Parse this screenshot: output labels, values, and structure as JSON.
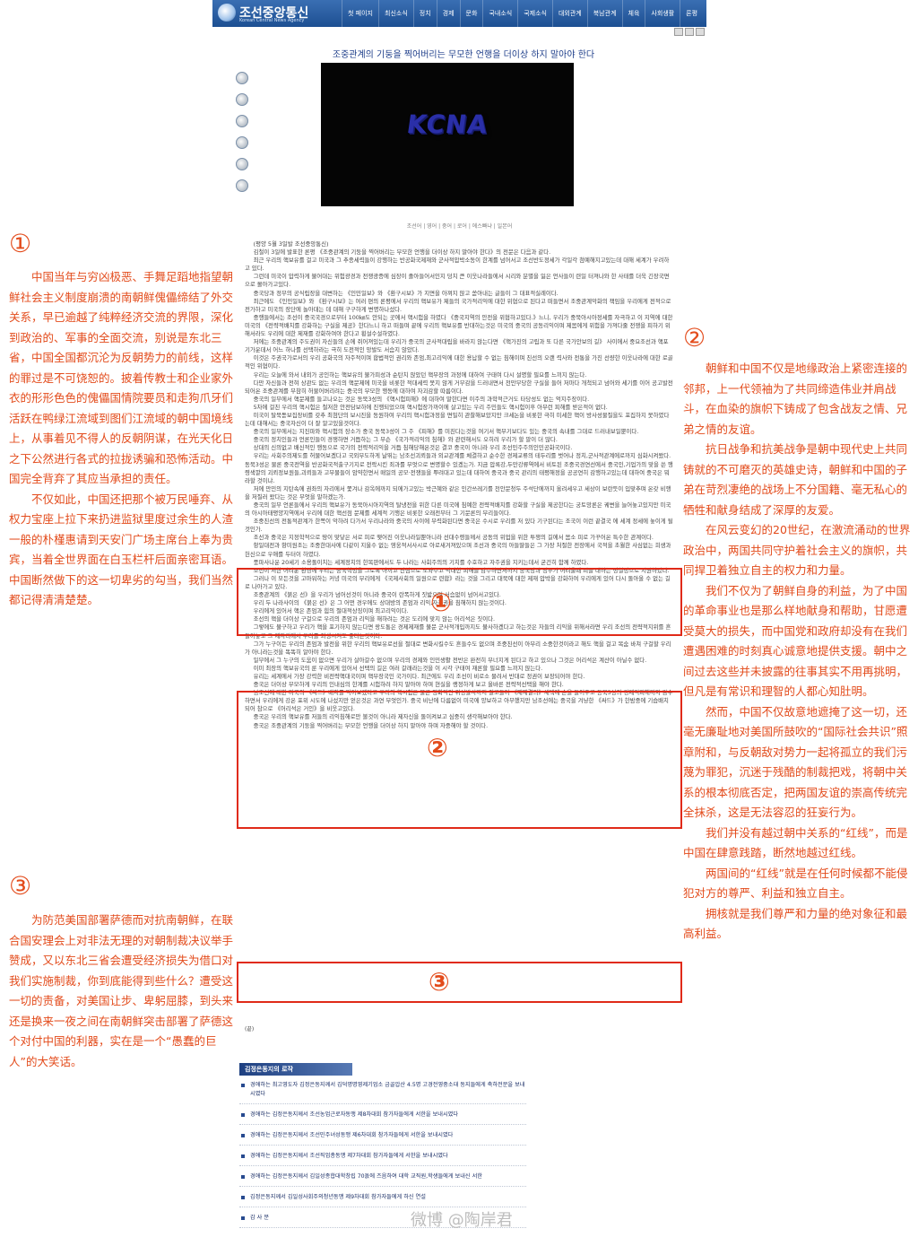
{
  "header": {
    "logo_title": "조선중앙통신",
    "logo_subtitle": "Korean Central News Agency",
    "nav": [
      "첫 페이지",
      "최신소식",
      "정치",
      "경제",
      "문화",
      "국내소식",
      "국제소식",
      "대외관계",
      "북남관계",
      "체육",
      "사회생활",
      "론평"
    ]
  },
  "article": {
    "headline": "조중관계의 기둥을 찍어버리는 무모한 언행을 더이상 하지 말아야 한다",
    "video_logo": "KCNA",
    "languages": "조선어 | 영어 | 중어 | 로어 | 에스빠냐 | 일본어",
    "paragraphs": [
      "(평양 5월 3일발 조선중앙통신)",
      "김철이 3일에 발표한 론평 《조중관계의 기둥을 찍어버리는 무모한 언행을 더이상 하지 말아야 한다》의 전문은 다음과 같다.",
      "최근 우리의 핵보유를 걸고 미국과 그 추종세력들이 강행하는 반공화국제재와 군사적압박소동이 한계를 넘어서고 조선반도정세가 각일각 첨예해지고있는데 대해 세계가 우려하고 있다.",
      "그런데 미국이 압력하게 불어대는 위험광경과 전쟁광증에 심장이 졸아들어서인지 덩치 큰 이웃나라들에서 시리와 분별을 잃은 언사들이 련일 터져나와 한 사태를 더욱 긴장국면으로 몰아가고있다.",
      "중국당과 정부의 공식립장을 대변하는 《인민일보》와 《환구시보》가 지면을 아껴지 않고 쏟아내는 글들이 그 대표적실례이다.",
      "최근에도 《인민일보》와 《환구시보》는 여러 편의 론평에서 우리의 핵보유가 제들의 국가적리익에 대한 위협으로 된다고 떠들면서 조중관계악화의 책임을 우리에게 전적으로 전가하고 미국의 장단에 놀아대는 데 대해 구구하게 변명하나섰다.",
      "중행들에서는 조선이 중국국경으로부터 100㎞도 안되는 곳에서 핵시험을 하였다 《중국지역의 안전을 위협하고있다.》느니, 우리가 중북아시아정세를 자극하고 이 지역에 대한 미국의 《전략적배치를 강화하는 구실을 제공》한다느니 하고 떠들며 끝에 우리의 핵보유를 반대하는것은 미국의 중국의 공동리익이며 제몸에게 위험을 가져다줄 전쟁을 피하기 위해서라도 우리에 대한 제재를 강화하여야 한다고 횡설수설하였다.",
      "저에는 조중관계의 주도권이 자신들의 손에 쥐어져있는데 우리가 중국의 군사적대립을 바라지 않는다면 《핵가진의 고립과 또 다른 국가안보의 길》 사이에서 중요조선과 핵포기가운데서 어느 하나를 선택하라는 극히 도전적인 망발도 서슴지 않았다.",
      "이것은 주권국가로서의 우리 공화국의 자주적이며 합법적인 권리와 존엄,최고리익에 대한 용납할 수 없는 침해이며 친선의 오랜 력사와 전통을 가진 선량한 이웃나라에 대한 로골적인 위협이다.",
      "우리는 오늘에 와서 내외가 공인하는 핵보유의 불가피성과 순탄치 않았던 핵무장의 과정에 대하여 구태여 다시 설명할 필요를 느끼지 않는다.",
      "다만 자신들과 전혀 상관도 없는 우리의 핵문제에 미국을 비롯한 적대세력 못지 않게 거부감을 드러내면서 천만부당한 구실을 들어 저마다 개척되고 넘어와 세기를 이어 공고발전되어온 조중관계를 무참히 허물어버리려는 중국의 무모한 행동에 대하여 자괴감할 따름이다.",
      "중국의 일부에서 핵문제를 들고나오는 것은 동북3성의 《핵시험피해》에 대하여 말한다면 이주의 과학적근거도 타당성도 없는 억지주장이다.",
      "5차에 걸친 우리의 핵시험은 철저한 안전담보하에 진행되었으며 핵시험장가까이에 살고있는 우리 주민들도 핵시험이후 아무런 피해를 받은적이 없다.",
      "미국이 탈북돋보집장비를 갖추 최첨단의 보시진을 동원하여 우리의 핵시험과정을 면밀히 관찰해보았지만 크세논을 비롯한 극히 미세한 핵이 방사성물질을도 포집하지 못하였다는데 대해서는 중국자신이 더 잘 알고있을것이다.",
      "중국의 일부에서는 지진파와 핵시험의 장소가 중국 동북3성이 그 주 《피해》를 미친다는것을 여기서 핵무기보다도 있는 중국의 속내를 그대로 드러내보일뿐이다.",
      "중국의 정치인들과 언론인들이 경쟁하면 거듭하는 그 무슨 《국가적리익의 침해》와 관련해서도 오히려 우리가 할 말이 더 많다.",
      "상대의 신의없고 배신적인 행동으로 국가의 전략적리익을 거듭 침해당해온것은 결코 중국이 아니라 우리 조선민주주의인민공화국이다.",
      "우리는 사회주의제도를 허물어보겠다고 국외무도하게 날뛰는 남조선괴뢰들과 외교관계를 체결하고 순수한 경제교류의 테두리를 벗어나 정치,군사적관계에로까지 심화시켜왔다. 동북3성은 물론 중국전역을 반공화국적출구기지로 전락시킨 죄과를 무엇으로 변명할수 있겠는가. 지금 압록강,두만강류역에서 비토된 조중국경연선에서 중국인,기업가의 맞을 쓴 행령색깔의 괴뢰정보원들,괴뢰들과 고무물들이 암약한면서 매일의 공모·전쟁들을 뿌려대고 있는데 대하여 중국과 중국 관리의 태평해정을 공공연히 감행하고있는데 대하여 중국은 뭐라할 것이냐.",
      "저에 만민의 지탄속에 권좌의 자리에서 쫓겨나 감옥에까지 되에가고있는 박근혜와 같은 인간쓰레기를 천안문청두 주석단에까지 올려세우고 세상이 보란듯이 입맞추며 온갖 비행을 저질러 왔다는 것은 무엇을 말하겠는가.",
      "중국의 일부 언론들에서 우리의 핵보유가 동북아시아지역의 탈냉전을 위한 다른 미국에 침예한 전략적배치를 강화할 구실을 제공한다는 궁토망론은 궤변을 늘어놓고있지만 미국의 아시아태평양지역에서 우리에 대한 핵선점 문제를 세계적 기행은 비롯한 오래전부터 그 기문론의 무리들이다.",
      "조중친선의 전통적관계가 한쪽이 악하려 다가서 우리나라와 중국의 사이에 무력화된다면 중국은 수시로 우리를 저 있다 기구된다는 조국이 이런 끝결국 에 세계 정세에 놓이게 될 것인가.",
      "조선과 중국은 지정학적으로 땅이 맞닿은 서로 피로 맺어진 이웃나라일뿐아니라 선대수령들께서 공동의 위업을 위한 투쟁의 길에서 몸소 피로 가꾸어온 특수한 관계이다.",
      "항일대전과 항미원조는 조중한대사에 다같이 지울수 없는 영웅적서사시로 아로새겨져있으며 조선과 중국의 아들딸들은 그 가장 처절한 전장에서 국적을 초월한 사심없는 희생과 헌신으로 우애를 두터이 하였다.",
      "풍파사나운 20세기 소용돌이치는 세계정치의 한복판에서도 두 나라는 사회주의의 기치를 수호하고 자주권을 지키는데서 굳건히 함께 하였다.",
      "조선이 처한 어려운 환경에 우리는 중국혁명을 그토록 아끼고 진심으로 도와주고 막대한 피해를 감수하면서까지 중국당과 정부가 어려울때 피를 대하는 성실성으로 지원하였다.",
      "그러나 이 모든것을 고마워하는 커녕 미국의 무리에게 《국제사회의 일원으로 련합》라는 것을 그리고 대북에 대한 제재 압박을 강화하여 우리에게 있어 다시 돌아올 수 없는 길로 나아가고 있다.",
      "조중관계의 《붉은 선》을 우리가 넘어선것이 아니라 중국이 란폭하게 짓밟으며 서슴없이 넘어서고있다.",
      "우리 두 나라사이의 《붉은 선》은 그 어떤 경우에도 상대방의 존엄과 리익,자주권을 침해하지 않는것이다.",
      "우리에게 있어서 핵은 존엄과 힘의 절대적상징이며 최고리익이다.",
      "조선의 핵을 더이상 구걸으로 우리의 존엄과 리익을 해하려는 것은 도리에 맞지 않는 어리석은 짓이다.",
      "그렇에도 불구하고 우리가 핵을 포기하지 않는다면 랑도통은 경제제재를 불문 군사적개입까지도 불사하겠다고 하는것은 자들의 리익을 위해서라면 우리 조선의 전략적지위를 흔들어놓고 그 제자리에서 우리를 희생시켜도 좋다는것이다.",
      "그가 누구이든 우리의 존엄과 발전을 위한 우리의 핵보유로선을 절대로 변화시킬수도 흔들수도 없으며 조중친선이 아무리 소중한것이라고 해도 핵을 걸고 목숨 바쳐 구걸할 우리가 아니라는것을 똑똑히 알아야 한다.",
      "일부에서 그 누구의 도움이 없으면 우리가 살아갈수 없으며 우리의 경제와 인민생활 전반은 완전히 무너지게 된다고 하고 있으나 그것은 어리석은 계산이 아닐수 없다.",
      "이미 최장의 핵보유국의 룬 우리에게 있어서 선택의 길은 여러 갈래라는것을 이 시각 구태여 재론할 필요를 느끼지 않는다.",
      "유리는 세계에서 가장 강력한 비전략핵대국이며 핵무장국인 국가이다. 최근에도 우리 조선이 비로소 물려서 반대로 정권이 보장되어야 한다.",
      "중국은 더이상 무모하게 우리의 인내심의 한계를 시험하려 하지 말아야 하며 현실을 랭정하게 보고 올바른 전략적선택을 해야 한다.",
      "남조선에 대한 미국의 《싸드》배치를 막아보겠다고 우리의 핵시험은 물론 평화적인 위성발사까지 걸고들어 《제재결의》채택에 손을 들어주고 동북3성의 경제적피해까지 감수하면서 우리에게 강온 포위 시도에 나섰지만 얻은것은 과연 무엇인가. 중국 비난에 다름없이 미국에 양보하고 아부했지만 남조선에는 중국을 겨냥한 《싸드》가 한밤중에 기습배치되어 참으로 《어리석은 거인》을 비웃고있다.",
      "중국은 우리의 핵보유를 저들의 리익침해로만 볼것이 아니라 제자신을 돌이켜보고 심중히 생각해보아야 한다.",
      "중국은 조중관계의 기둥을 찍어버리는 무모한 언행을 더이상 하지 말아야 하며 자중해야 할 것이다."
    ],
    "end_mark": "(끝)"
  },
  "related": {
    "title": "김정은동지의 로작",
    "items": [
      "경애하는 최고영도자 김정은동지께서 김덕명명영제기업소 금골압산 4.5명 고경전영중소대 동지들에게 축하전문을 보내시였다",
      "경애하는 김정은동지께서 조선농업근로자동맹 제8차대회 참가자들에게 서한을 보내시였다",
      "경애하는 김정은동지께서 조선민주녀성동맹 제6차대회 참가자들에게 서한을 보내시였다",
      "경애하는 김정은동지께서 조선직업총동맹 제7차대회 참가자들에게 서한을 보내시였다",
      "경애하는 김정은동지께서 김일성종합대학창립 70돐에 즈음하여 대학 교직원,학생들에게 보내신 서한",
      "김정은동지께서 김일성사회주의청년동맹 제9차대회 참가자들에게 하신 연설",
      "감 사 분"
    ]
  },
  "annotations": {
    "image_markers": [
      "①",
      "②",
      "③"
    ],
    "left_1": {
      "num": "①",
      "paragraphs": [
        "中国当年与穷凶极恶、手舞足蹈地指望朝鲜社会主义制度崩溃的南朝鲜傀儡缔结了外交关系，早已逾越了纯粹经济交流的界限，深化到政治的、军事的全面交流，别说是东北三省，中国全国都沉沦为反朝势力的前线，这样的罪过是不可饶恕的。披着传教士和企业家外衣的形形色色的傀儡国情院要员和走狗爪牙们活跃在鸭绿江流域到图们江流域的朝中国境线上，从事着见不得人的反朝阴谋，在光天化日之下公然进行各式的拉拢诱骗和恐怖活动。中国完全背弃了其应当承担的责任。",
        "不仅如此，中国还把那个被万民唾弃、从权力宝座上拉下来扔进监狱里度过余生的人渣一般的朴槿惠请到天安门广场主席台上奉为贵宾，当着全世界面在白玉栏杆后面亲密耳语。中国断然做下的这一切卑劣的勾当，我们当然都记得清清楚楚。"
      ]
    },
    "right_2": {
      "num": "②",
      "paragraphs": [
        "朝鲜和中国不仅是地缘政治上紧密连接的邻邦，上一代领袖为了共同缔造伟业并肩战斗，在血染的旗帜下铸成了包含战友之情、兄弟之情的友谊。",
        "抗日战争和抗美战争是朝中现代史上共同铸就的不可磨灭的英雄史诗，朝鲜和中国的子弟在苛烈凄绝的战场上不分国籍、毫无私心的牺牲和献身结成了深厚的友爱。",
        "在风云变幻的20世纪，在激流涌动的世界政治中，两国共同守护着社会主义的旗帜，共同捍卫着独立自主的权力和力量。",
        "我们不仅为了朝鲜自身的利益，为了中国的革命事业也是那么样地献身和帮助，甘愿遭受莫大的损失，而中国党和政府却没有在我们遭遇困难的时刻真心诚意地提供支援。朝中之间过去这些并未披露的往事其实不用再挑明，但凡是有常识和理智的人都心知肚明。",
        "然而，中国不仅故意地遮掩了这一切，还毫无廉耻地对美国所鼓吹的“国际社会共识”照章附和，与反朝敌对势力一起将孤立的我们污蔑为罪犯，沉迷于残酷的制裁把戏，将朝中关系的根本彻底否定，把两国友谊的崇高传统完全抹杀，这是无法容忍的狂妄行为。",
        "我们并没有越过朝中关系的“红线”，而是中国在肆意践踏，断然地越过红线。",
        "两国间的“红线”就是在任何时候都不能侵犯对方的尊严、利益和独立自主。",
        "拥核就是我们尊严和力量的绝对象征和最高利益。"
      ]
    },
    "left_3": {
      "num": "③",
      "paragraphs": [
        "为防范美国部署萨德而对抗南朝鲜，在联合国安理会上对非法无理的对朝制裁决议举手赞成，又以东北三省会遭受经济损失为借口对我们实施制裁，你到底能得到些什么？遭受这一切的责备，对美国让步、卑躬屈膝，到头来还是换来一夜之间在南朝鲜突击部署了萨德这个对付中国的利器，实在是一个“愚蠢的巨人”的大笑话。"
      ]
    },
    "watermark": "微博 @陶岸君"
  },
  "colors": {
    "header_blue": "#1d4f92",
    "annotation_red": "#e02a18",
    "annotation_text": "#e34b1b",
    "headline_blue": "#1e3e8a"
  }
}
